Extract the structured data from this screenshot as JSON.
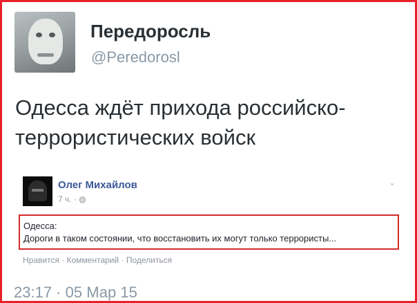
{
  "tweet": {
    "author_name": "Передоросль",
    "handle": "@Peredorosl",
    "text": "Одесса ждёт прихода российско-террористических войск",
    "timestamp": "23:17 · 05 Мар 15"
  },
  "fb_post": {
    "author": "Олег Михайлов",
    "meta": "7 ч. · ◍",
    "line1": "Одесса:",
    "line2": "Дороги в таком состоянии, что восстановить их могут только террористы...",
    "actions": "Нравится · Комментарий · Поделиться"
  },
  "colors": {
    "highlight_border": "#d52a2a",
    "frame_border": "#e8202a",
    "fb_link": "#3b5998"
  }
}
